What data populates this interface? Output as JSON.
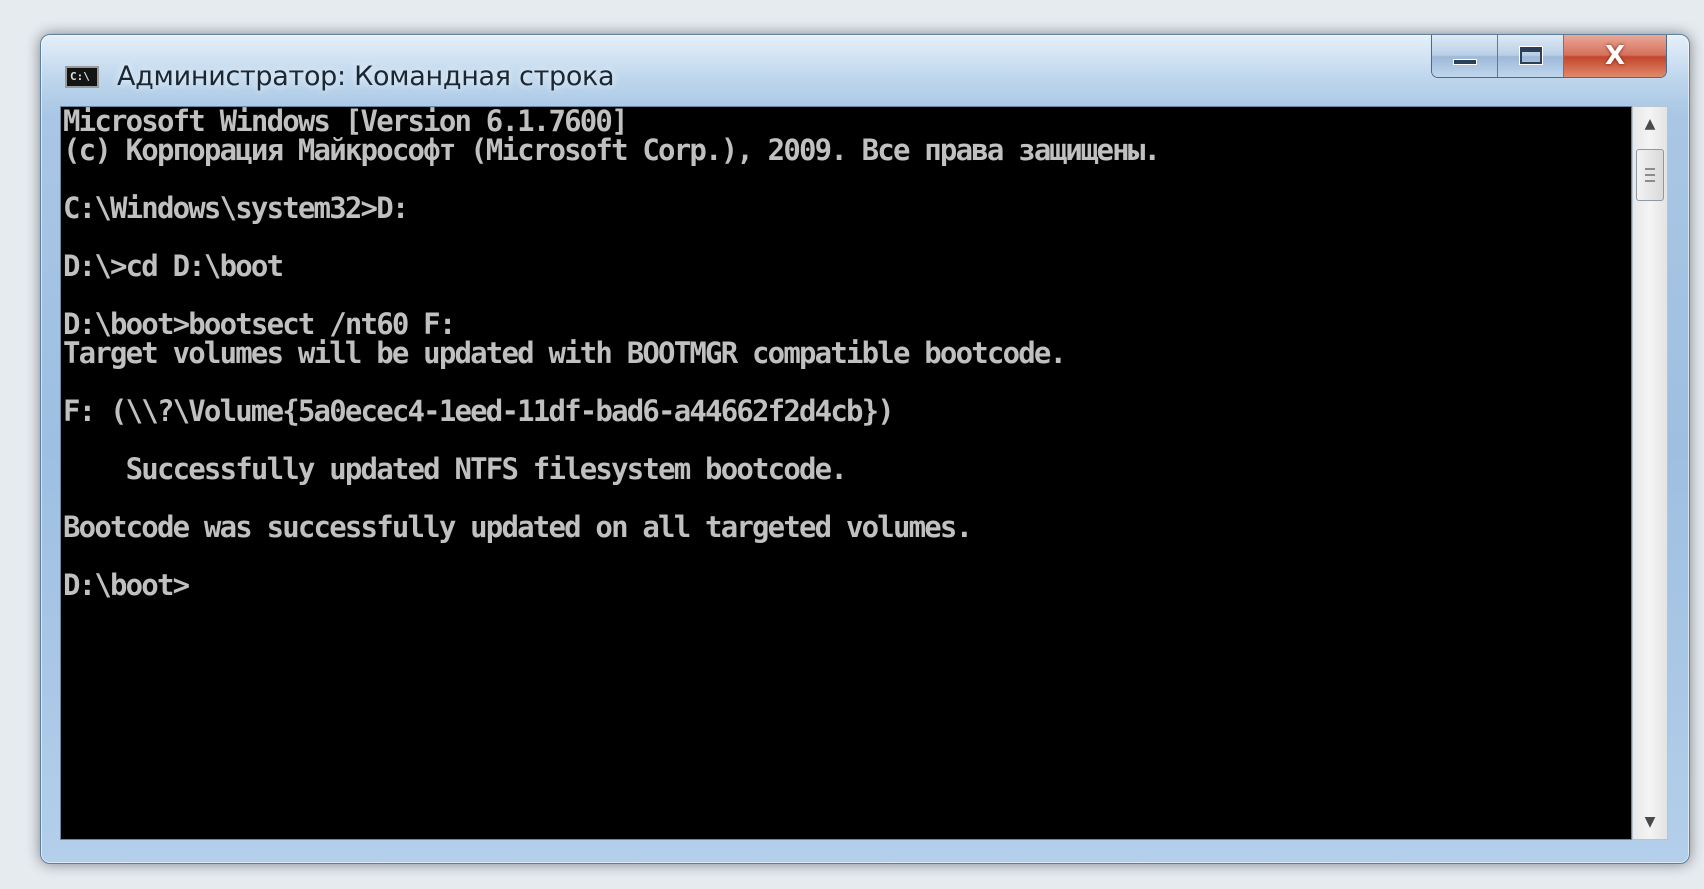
{
  "window": {
    "title": "Администратор: Командная строка",
    "icon": "cmd-icon",
    "icon_text": "C:\\",
    "buttons": {
      "minimize": "minimize-icon",
      "maximize": "maximize-icon",
      "close_label": "X"
    }
  },
  "console": {
    "lines": [
      "Microsoft Windows [Version 6.1.7600]",
      "(c) Корпорация Майкрософт (Microsoft Corp.), 2009. Все права защищены.",
      "",
      "C:\\Windows\\system32>D:",
      "",
      "D:\\>cd D:\\boot",
      "",
      "D:\\boot>bootsect /nt60 F:",
      "Target volumes will be updated with BOOTMGR compatible bootcode.",
      "",
      "F: (\\\\?\\Volume{5a0ecec4-1eed-11df-bad6-a44662f2d4cb})",
      "",
      "    Successfully updated NTFS filesystem bootcode.",
      "",
      "Bootcode was successfully updated on all targeted volumes.",
      "",
      "D:\\boot>"
    ]
  },
  "scrollbar": {
    "up_arrow": "▲",
    "down_arrow": "▼"
  },
  "colors": {
    "console_background": "#000000",
    "console_text": "#c0c0c0",
    "frame": "#a9c7e4",
    "close_button": "#c2462c"
  }
}
